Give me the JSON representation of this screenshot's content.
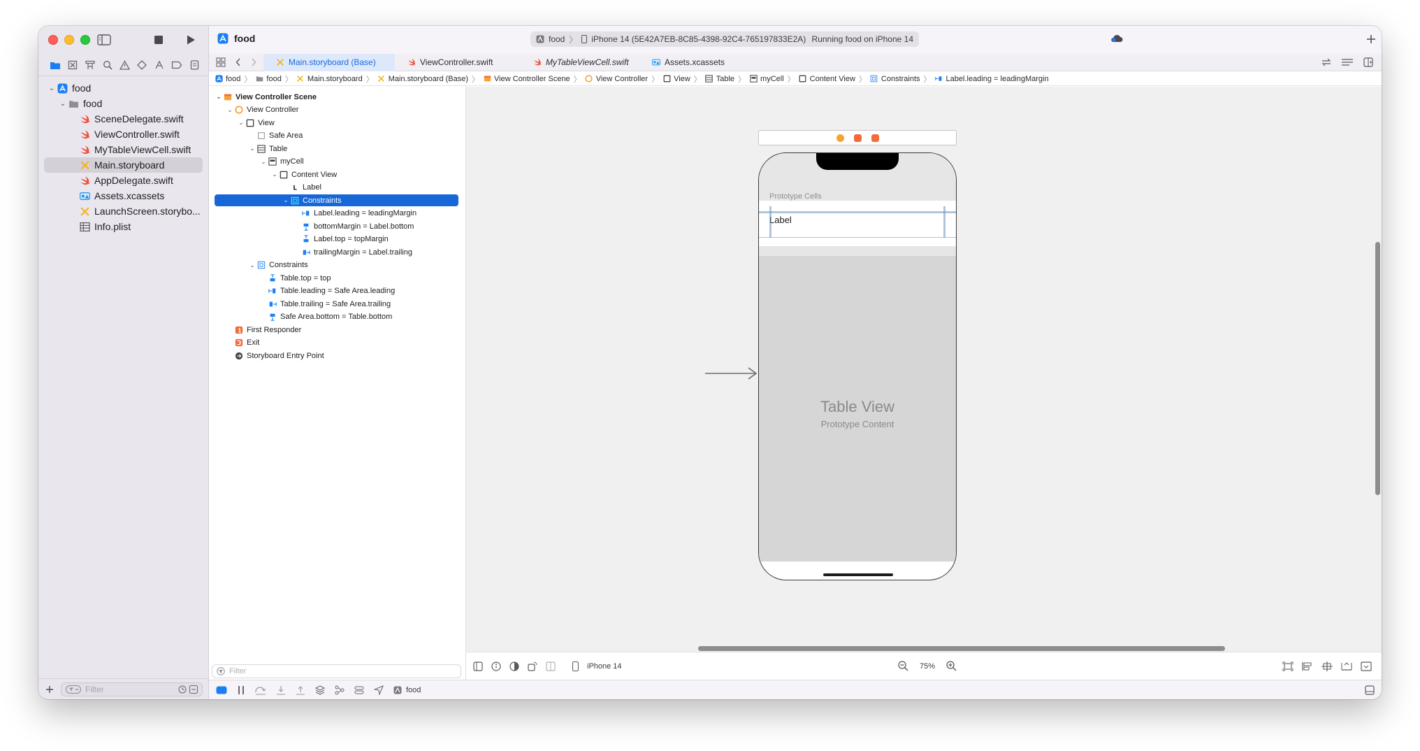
{
  "window": {
    "project_title": "food",
    "scheme": {
      "target": "food",
      "device": "iPhone 14 (5E42A7EB-8C85-4398-92C4-765197833E2A)",
      "status": "Running food on iPhone 14"
    }
  },
  "navigator": {
    "items": [
      {
        "label": "food",
        "kind": "project",
        "level": 0,
        "expanded": true
      },
      {
        "label": "food",
        "kind": "folder",
        "level": 1,
        "expanded": true
      },
      {
        "label": "SceneDelegate.swift",
        "kind": "swift",
        "level": 2
      },
      {
        "label": "ViewController.swift",
        "kind": "swift",
        "level": 2
      },
      {
        "label": "MyTableViewCell.swift",
        "kind": "swift",
        "level": 2
      },
      {
        "label": "Main.storyboard",
        "kind": "storyboard",
        "level": 2,
        "selected": true
      },
      {
        "label": "AppDelegate.swift",
        "kind": "swift",
        "level": 2
      },
      {
        "label": "Assets.xcassets",
        "kind": "assets",
        "level": 2
      },
      {
        "label": "LaunchScreen.storybo...",
        "kind": "storyboard",
        "level": 2
      },
      {
        "label": "Info.plist",
        "kind": "plist",
        "level": 2
      }
    ],
    "filter_placeholder": "Filter"
  },
  "tabs": [
    {
      "label": "Main.storyboard (Base)",
      "kind": "storyboard",
      "active": true
    },
    {
      "label": "ViewController.swift",
      "kind": "swift"
    },
    {
      "label": "MyTableViewCell.swift",
      "kind": "swift",
      "italic": true
    },
    {
      "label": "Assets.xcassets",
      "kind": "assets"
    }
  ],
  "breadcrumb": [
    {
      "label": "food",
      "kind": "project"
    },
    {
      "label": "food",
      "kind": "folder"
    },
    {
      "label": "Main.storyboard",
      "kind": "storyboard"
    },
    {
      "label": "Main.storyboard (Base)",
      "kind": "storyboard"
    },
    {
      "label": "View Controller Scene",
      "kind": "scene"
    },
    {
      "label": "View Controller",
      "kind": "vc"
    },
    {
      "label": "View",
      "kind": "view"
    },
    {
      "label": "Table",
      "kind": "table"
    },
    {
      "label": "myCell",
      "kind": "cell"
    },
    {
      "label": "Content View",
      "kind": "view"
    },
    {
      "label": "Constraints",
      "kind": "constraints"
    },
    {
      "label": "Label.leading = leadingMargin",
      "kind": "constraint-lead"
    }
  ],
  "outline": {
    "rows": [
      {
        "label": "View Controller Scene",
        "level": 0,
        "chev": "v",
        "kind": "scene",
        "bold": true
      },
      {
        "label": "View Controller",
        "level": 1,
        "chev": "v",
        "kind": "vc"
      },
      {
        "label": "View",
        "level": 2,
        "chev": "v",
        "kind": "view"
      },
      {
        "label": "Safe Area",
        "level": 3,
        "chev": "",
        "kind": "safearea"
      },
      {
        "label": "Table",
        "level": 3,
        "chev": "v",
        "kind": "table"
      },
      {
        "label": "myCell",
        "level": 4,
        "chev": "v",
        "kind": "cell"
      },
      {
        "label": "Content View",
        "level": 5,
        "chev": "v",
        "kind": "view"
      },
      {
        "label": "Label",
        "level": 6,
        "chev": "",
        "kind": "label"
      },
      {
        "label": "Constraints",
        "level": 6,
        "chev": "v",
        "kind": "constraints",
        "selected": true
      },
      {
        "label": "Label.leading = leadingMargin",
        "level": 7,
        "chev": "",
        "kind": "constraint-lead"
      },
      {
        "label": "bottomMargin = Label.bottom",
        "level": 7,
        "chev": "",
        "kind": "constraint-bottom"
      },
      {
        "label": "Label.top = topMargin",
        "level": 7,
        "chev": "",
        "kind": "constraint-top"
      },
      {
        "label": "trailingMargin = Label.trailing",
        "level": 7,
        "chev": "",
        "kind": "constraint-trail"
      },
      {
        "label": "Constraints",
        "level": 3,
        "chev": "v",
        "kind": "constraints"
      },
      {
        "label": "Table.top = top",
        "level": 4,
        "chev": "",
        "kind": "constraint-top"
      },
      {
        "label": "Table.leading = Safe Area.leading",
        "level": 4,
        "chev": "",
        "kind": "constraint-lead"
      },
      {
        "label": "Table.trailing = Safe Area.trailing",
        "level": 4,
        "chev": "",
        "kind": "constraint-trail"
      },
      {
        "label": "Safe Area.bottom = Table.bottom",
        "level": 4,
        "chev": "",
        "kind": "constraint-bottom"
      },
      {
        "label": "First Responder",
        "level": 1,
        "chev": "",
        "kind": "responder"
      },
      {
        "label": "Exit",
        "level": 1,
        "chev": "",
        "kind": "exit"
      },
      {
        "label": "Storyboard Entry Point",
        "level": 1,
        "chev": "",
        "kind": "entry"
      }
    ],
    "filter_placeholder": "Filter"
  },
  "canvas": {
    "prototype_cells_label": "Prototype Cells",
    "cell_label": "Label",
    "table_view_title": "Table View",
    "table_view_subtitle": "Prototype Content",
    "device_name": "iPhone 14",
    "zoom": "75%"
  },
  "debug": {
    "target": "food"
  },
  "colors": {
    "accent": "#1767d8",
    "swift_orange": "#f05138",
    "storyboard_yellow": "#f4b321",
    "xcode_blue": "#1b7ff4"
  }
}
